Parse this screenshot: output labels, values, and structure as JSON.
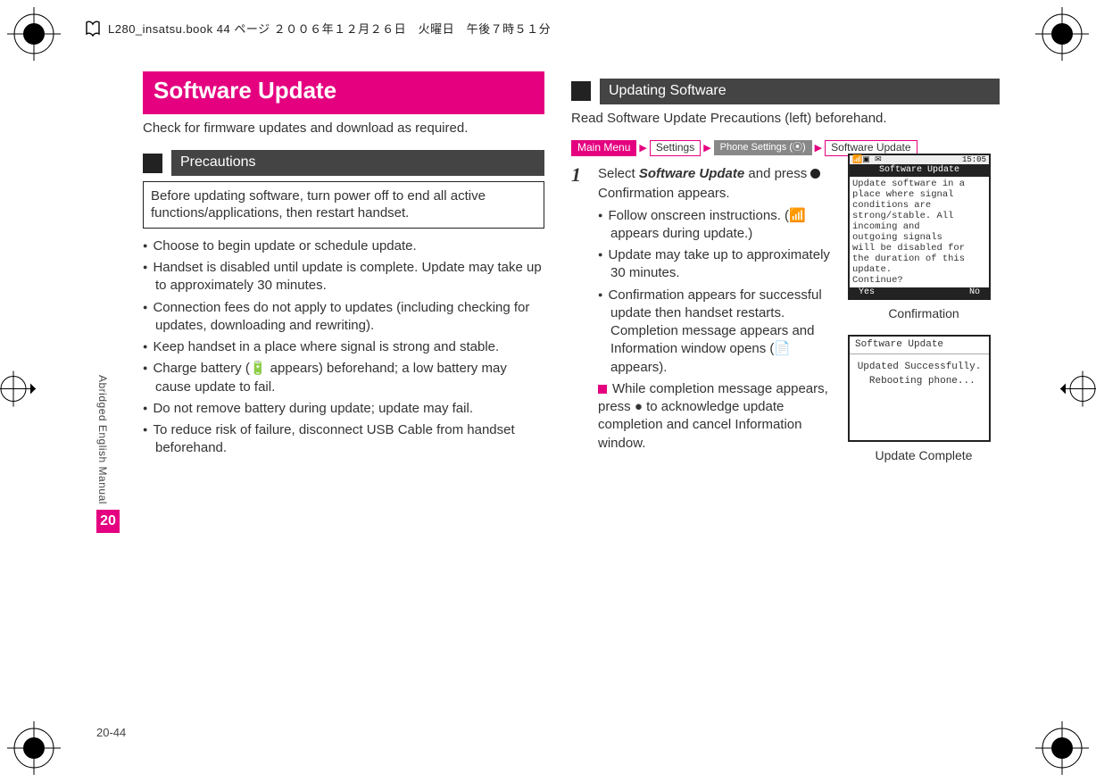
{
  "meta": {
    "header_line": "L280_insatsu.book  44 ページ  ２００６年１２月２６日　火曜日　午後７時５１分",
    "side_label": "Abridged English Manual",
    "side_chapter": "20",
    "page_number": "20-44"
  },
  "left": {
    "title": "Software Update",
    "intro": "Check for firmware updates and download as required.",
    "precautions_heading": "Precautions",
    "precautions_box": "Before updating software, turn power off to end all active functions/applications, then restart handset.",
    "bullets": [
      "Choose to begin update or schedule update.",
      "Handset is disabled until update is complete. Update may take up to approximately 30 minutes.",
      "Connection fees do not apply to updates (including checking for updates, downloading and rewriting).",
      "Keep handset in a place where signal is strong and stable.",
      "Charge battery (🔋 appears) beforehand; a low battery may cause update to fail.",
      "Do not remove battery during update; update may fail.",
      "To reduce risk of failure, disconnect USB Cable from handset beforehand."
    ]
  },
  "right": {
    "updating_heading": "Updating Software",
    "updating_intro": "Read Software Update Precautions (left) beforehand.",
    "nav": {
      "main": "Main Menu",
      "settings": "Settings",
      "phone_settings": "Phone Settings (⦿)",
      "software_update": "Software Update"
    },
    "step_number": "1",
    "step_title_prefix": "Select ",
    "step_title_em": "Software Update",
    "step_title_suffix": " and press ",
    "step_confirm": "Confirmation appears.",
    "step_bullets": [
      "Follow onscreen instructions. (📶 appears during update.)",
      "Update may take up to approximately 30 minutes.",
      "Confirmation appears for successful update then handset restarts. Completion message appears and Information window opens (📄 appears)."
    ],
    "step_note": "While completion message appears, press ● to acknowledge update completion and cancel Information window."
  },
  "figures": {
    "confirm": {
      "clock": "15:05",
      "titlebar": "Software Update",
      "body": "Update software in a\nplace where signal\nconditions are\nstrong/stable. All\nincoming and\noutgoing signals\nwill be disabled for\nthe duration of this\nupdate.\nContinue?",
      "soft_left": "Yes",
      "soft_right": "No",
      "caption": "Confirmation"
    },
    "complete": {
      "topbar": "Software Update",
      "body": "Updated Successfully.\n Rebooting phone...",
      "caption": "Update Complete"
    }
  }
}
